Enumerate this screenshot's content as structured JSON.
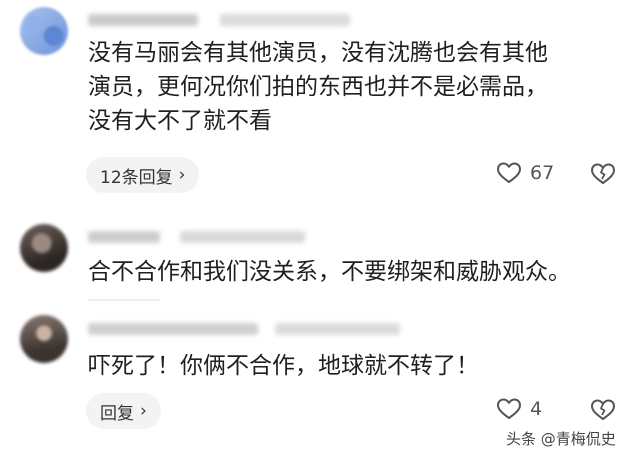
{
  "comments": [
    {
      "text_lines": [
        "没有马丽会有其他演员，没有沈腾也会有其他",
        "演员，更何况你们拍的东西也并不是必需品，",
        "没有大不了就不看"
      ],
      "reply_label": "12条回复",
      "likes": "67"
    },
    {
      "text_lines": [
        "合不合作和我们没关系，不要绑架和威胁观众。"
      ]
    },
    {
      "text_lines": [
        "吓死了！你俩不合作，地球就不转了！"
      ],
      "reply_label": "回复",
      "likes": "4"
    }
  ],
  "watermark": {
    "text": "头条 @青梅侃史"
  },
  "icons": {
    "like": "heart-outline-icon",
    "dislike": "broken-heart-icon",
    "chevron": "chevron-right-icon"
  },
  "colors": {
    "background": "#ffffff",
    "text": "#1f1f1f",
    "pill_bg": "#f3f3f3",
    "icon": "#555555"
  }
}
